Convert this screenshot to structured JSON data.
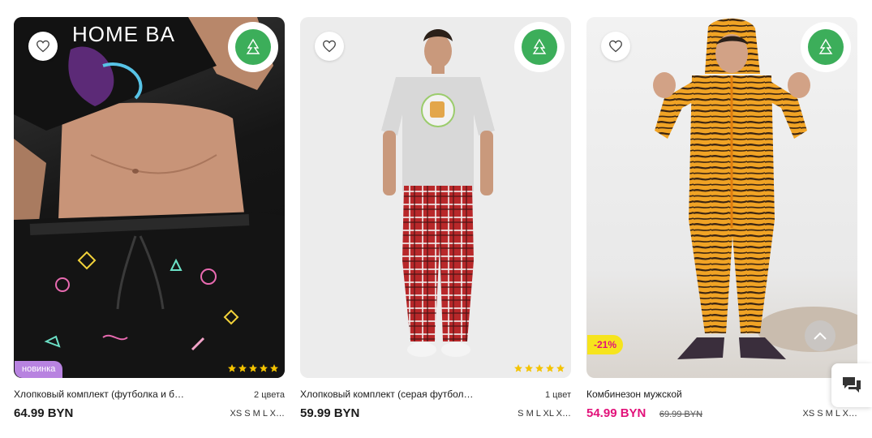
{
  "products": [
    {
      "name": "Хлопковый комплект (футболка и б…",
      "colors": "2 цвета",
      "price": "64.99 BYN",
      "old_price": "",
      "sizes": "XS S M L X…",
      "badge": "новинка",
      "stars": 5,
      "photo_subject": "man in black pajama set with print, lifting t-shirt",
      "print_text": "HOME BA"
    },
    {
      "name": "Хлопковый комплект (серая футбол…",
      "colors": "1 цвет",
      "price": "59.99 BYN",
      "old_price": "",
      "sizes": "S M L XL X…",
      "badge": "",
      "stars": 5,
      "photo_subject": "man in grey t-shirt and red plaid pants"
    },
    {
      "name": "Комбинезон мужской",
      "colors": "",
      "price": "54.99 BYN",
      "old_price": "69.99 BYN",
      "sizes": "XS S M L X…",
      "badge": "-21%",
      "stars": 0,
      "photo_subject": "man in tiger print onesie"
    }
  ],
  "colors": {
    "sale": "#e2127a",
    "new_badge": "#b883e0",
    "sale_badge": "#f6e41d",
    "star": "#f4c300",
    "seal_green": "#3cae5a"
  },
  "icons": {
    "favorite": "heart-outline-icon",
    "collection_seal": "new-year-collection-seal",
    "scroll_up": "chevron-up-icon",
    "chat": "chat-icon"
  }
}
